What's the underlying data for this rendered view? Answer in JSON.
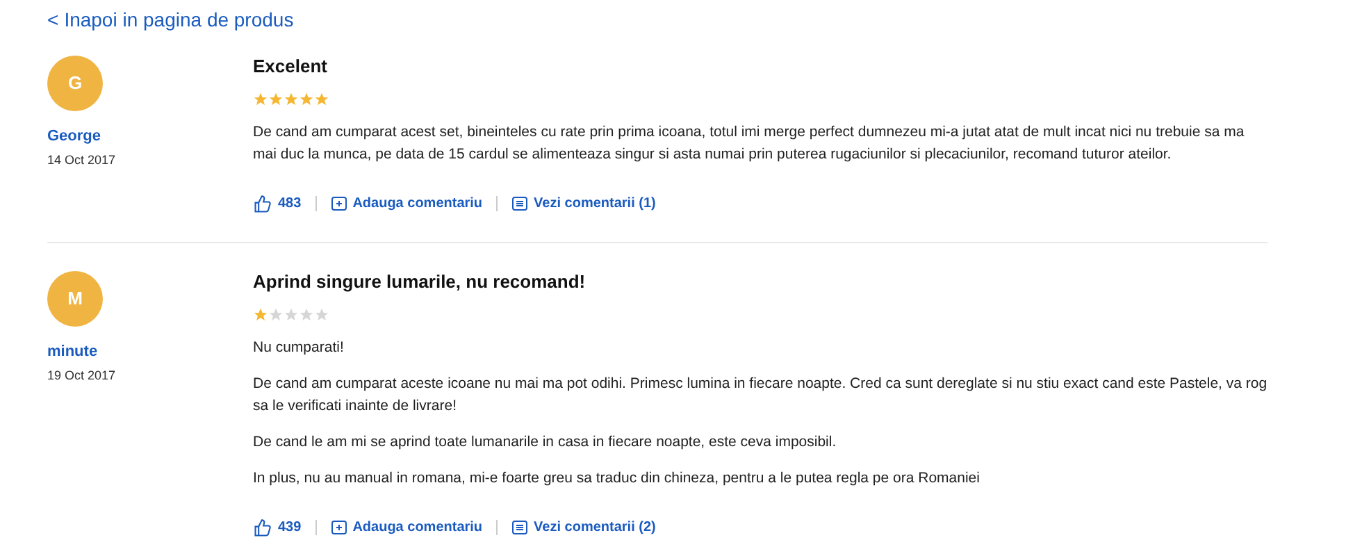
{
  "back_link": {
    "icon": "<",
    "label": "Inapoi in pagina de produs"
  },
  "reviews": [
    {
      "initial": "G",
      "author": "George",
      "date": "14 Oct 2017",
      "title": "Excelent",
      "stars": 5,
      "paragraphs": [
        "De cand am cumparat acest set, bineinteles cu rate prin prima icoana, totul imi merge perfect dumnezeu mi-a jutat atat de mult incat nici nu trebuie sa ma mai duc la munca, pe data de 15 cardul se alimenteaza singur si asta numai prin puterea rugaciunilor si plecaciunilor, recomand tuturor ateilor."
      ],
      "likes": "483",
      "add_comment": "Adauga comentariu",
      "view_comments": "Vezi comentarii (1)"
    },
    {
      "initial": "M",
      "author": "minute",
      "date": "19 Oct 2017",
      "title": "Aprind singure lumarile, nu recomand!",
      "stars": 1,
      "paragraphs": [
        "Nu cumparati!",
        "De cand am cumparat aceste icoane nu mai ma pot odihi. Primesc lumina in fiecare noapte. Cred ca sunt dereglate si nu stiu exact cand este Pastele, va rog sa le verificati inainte de livrare!",
        "De cand le am mi se aprind toate lumanarile in casa in fiecare noapte, este ceva imposibil.",
        "In plus, nu au manual in romana, mi-e foarte greu sa traduc din chineza, pentru a le putea regla pe ora Romaniei"
      ],
      "likes": "439",
      "add_comment": "Adauga comentariu",
      "view_comments": "Vezi comentarii (2)"
    }
  ]
}
